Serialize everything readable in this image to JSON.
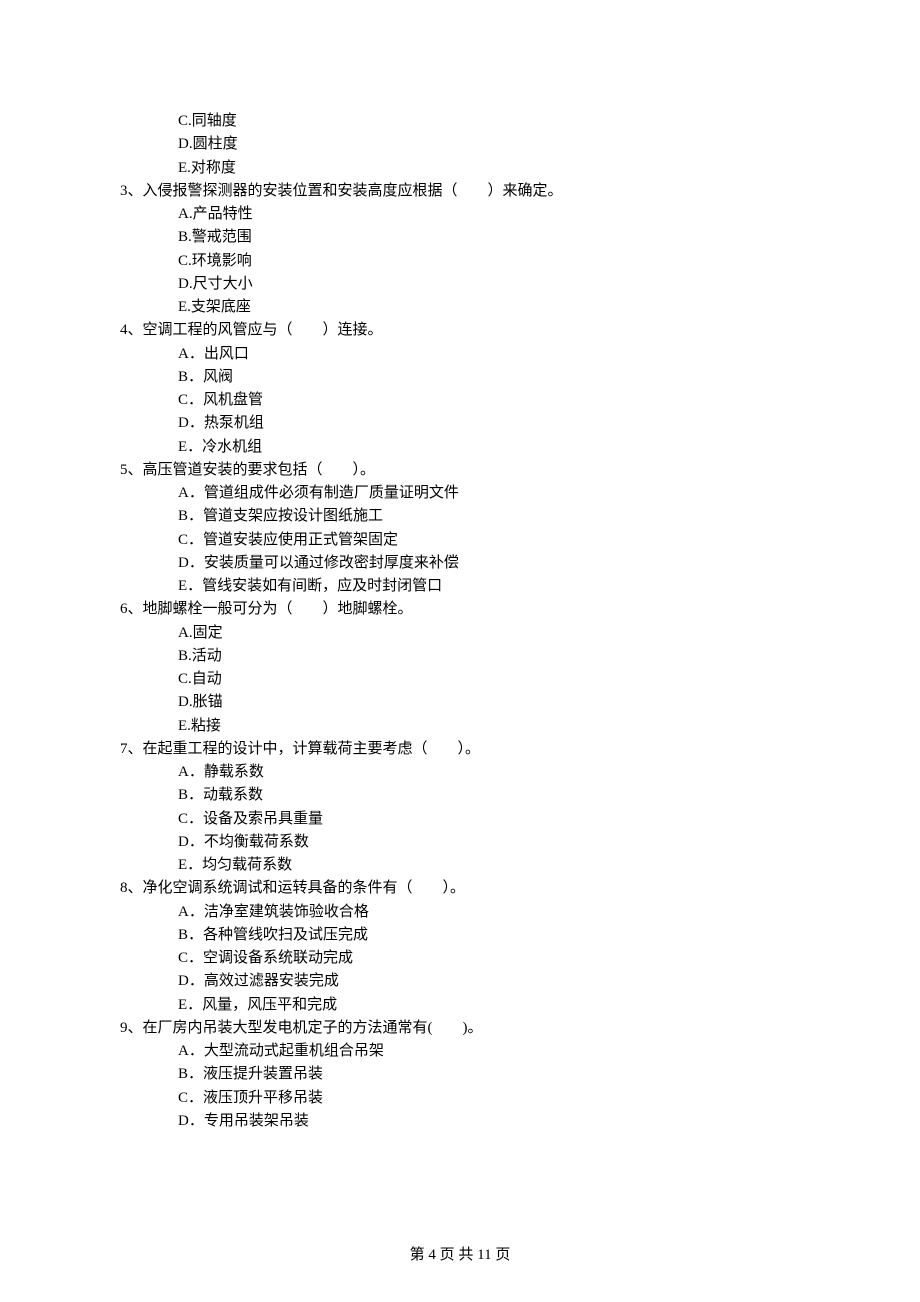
{
  "prev_options": {
    "C": "C.同轴度",
    "D": "D.圆柱度",
    "E": "E.对称度"
  },
  "questions": [
    {
      "stem": "3、入侵报警探测器的安装位置和安装高度应根据（　　）来确定。",
      "options": [
        "A.产品特性",
        "B.警戒范围",
        "C.环境影响",
        "D.尺寸大小",
        "E.支架底座"
      ]
    },
    {
      "stem": "4、空调工程的风管应与（　　）连接。",
      "options": [
        "A．出风口",
        "B．风阀",
        "C．风机盘管",
        "D．热泵机组",
        "E．冷水机组"
      ]
    },
    {
      "stem": "5、高压管道安装的要求包括（　　）。",
      "options": [
        "A．管道组成件必须有制造厂质量证明文件",
        "B．管道支架应按设计图纸施工",
        "C．管道安装应使用正式管架固定",
        "D．安装质量可以通过修改密封厚度来补偿",
        "E．管线安装如有间断，应及时封闭管口"
      ]
    },
    {
      "stem": "6、地脚螺栓一般可分为（　　）地脚螺栓。",
      "options": [
        "A.固定",
        "B.活动",
        "C.自动",
        "D.胀锚",
        "E.粘接"
      ]
    },
    {
      "stem": "7、在起重工程的设计中，计算载荷主要考虑（　　）。",
      "options": [
        "A．静载系数",
        "B．动载系数",
        "C．设备及索吊具重量",
        "D．不均衡载荷系数",
        "E．均匀载荷系数"
      ]
    },
    {
      "stem": "8、净化空调系统调试和运转具备的条件有（　　）。",
      "options": [
        "A．洁净室建筑装饰验收合格",
        "B．各种管线吹扫及试压完成",
        "C．空调设备系统联动完成",
        "D．高效过滤器安装完成",
        "E．风量，风压平和完成"
      ]
    },
    {
      "stem": "9、在厂房内吊装大型发电机定子的方法通常有(　　)。",
      "options": [
        "A．大型流动式起重机组合吊架",
        "B．液压提升装置吊装",
        "C．液压顶升平移吊装",
        "D．专用吊装架吊装"
      ]
    }
  ],
  "footer": "第 4 页 共 11 页"
}
